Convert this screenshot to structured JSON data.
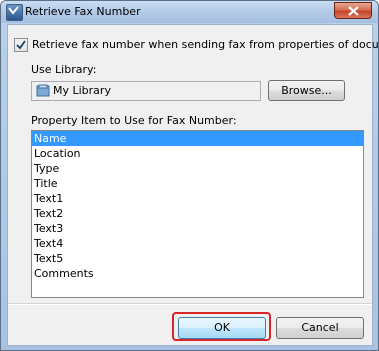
{
  "window": {
    "title": "Retrieve Fax Number"
  },
  "checkbox": {
    "label": "Retrieve fax number when sending fax from properties of document",
    "checked": true
  },
  "library": {
    "label": "Use Library:",
    "value": "My Library",
    "browse_label": "Browse..."
  },
  "property": {
    "label": "Property Item to Use for Fax Number:",
    "items": [
      "Name",
      "Location",
      "Type",
      "Title",
      "Text1",
      "Text2",
      "Text3",
      "Text4",
      "Text5",
      "Comments"
    ],
    "selected": "Name"
  },
  "buttons": {
    "ok_label": "OK",
    "cancel_label": "Cancel"
  },
  "colors": {
    "selection": "#3399ff",
    "ok_highlight": "#d9262b"
  },
  "icons": {
    "app": "app-icon",
    "close": "close-icon",
    "library": "library-icon",
    "check": "checkmark-icon"
  }
}
